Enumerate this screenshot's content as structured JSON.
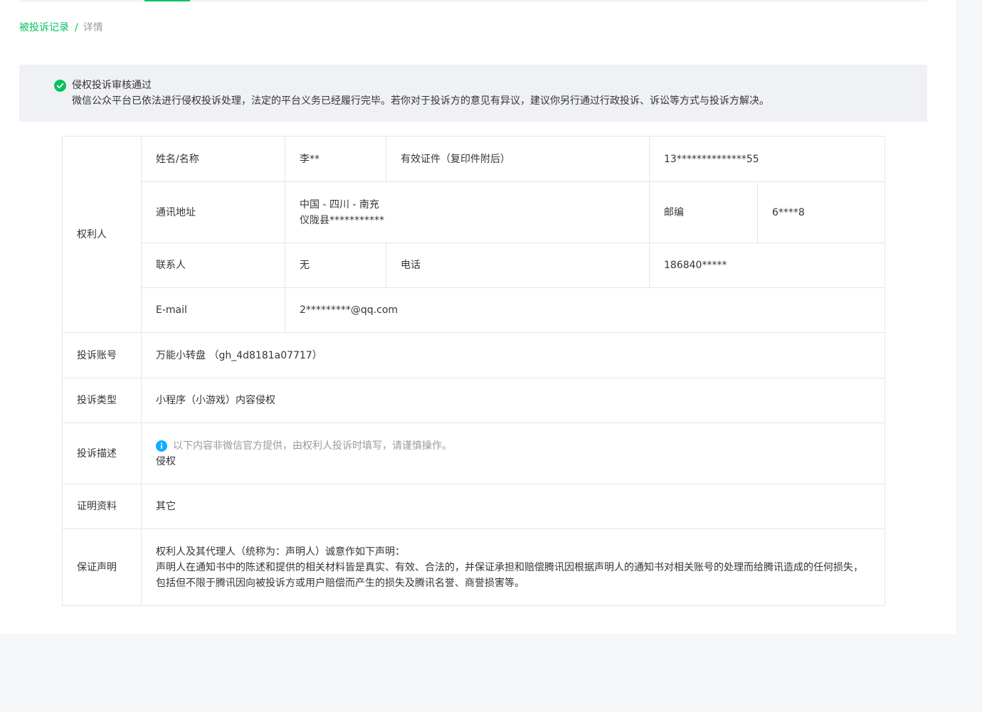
{
  "breadcrumb": {
    "parent": "被投诉记录",
    "separator": "/",
    "current": "详情"
  },
  "notice": {
    "title": "侵权投诉审核通过",
    "description": "微信公众平台已依法进行侵权投诉处理，法定的平台义务已经履行完毕。若你对于投诉方的意见有异议，建议你另行通过行政投诉、诉讼等方式与投诉方解决。",
    "icon": "check-circle-icon",
    "color": "#07c160"
  },
  "rights_holder": {
    "section_label": "权利人",
    "name_label": "姓名/名称",
    "name_value": "李**",
    "id_label": "有效证件（复印件附后）",
    "id_value": "13**************55",
    "address_label": "通讯地址",
    "address_line1": "中国 - 四川 - 南充",
    "address_line2": "仪陇县***********",
    "postcode_label": "邮编",
    "postcode_value": "6****8",
    "contact_label": "联系人",
    "contact_value": "无",
    "phone_label": "电话",
    "phone_value": "186840*****",
    "email_label": "E-mail",
    "email_value": "2*********@qq.com"
  },
  "complaint": {
    "account_label": "投诉账号",
    "account_value": "万能小转盘 （gh_4d8181a07717）",
    "type_label": "投诉类型",
    "type_value": "小程序（小游戏）内容侵权",
    "description_label": "投诉描述",
    "description_tip": "以下内容非微信官方提供，由权利人投诉时填写，请谨慎操作。",
    "description_tip_icon": "info-icon",
    "description_tip_color": "#10aeff",
    "description_value": "侵权",
    "evidence_label": "证明资料",
    "evidence_value": "其它",
    "statement_label": "保证声明",
    "statement_line1": "权利人及其代理人（统称为：声明人）诚意作如下声明：",
    "statement_line2": "声明人在通知书中的陈述和提供的相关材料皆是真实、有效、合法的，并保证承担和赔偿腾讯因根据声明人的通知书对相关账号的处理而给腾讯造成的任何损失，",
    "statement_line3": "包括但不限于腾讯因向被投诉方或用户赔偿而产生的损失及腾讯名誉、商誉损害等。"
  }
}
